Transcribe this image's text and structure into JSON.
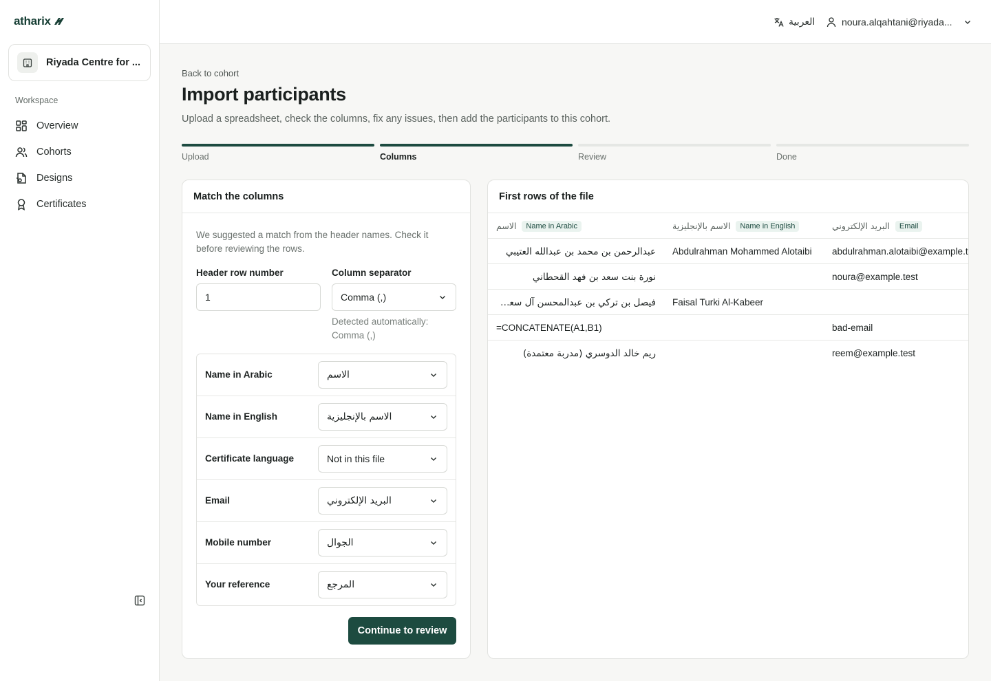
{
  "app": {
    "logo_text": "atharix",
    "organization": "Riyada Centre for ..."
  },
  "sidebar": {
    "section_label": "Workspace",
    "items": [
      {
        "label": "Overview",
        "icon": "grid-icon"
      },
      {
        "label": "Cohorts",
        "icon": "users-icon"
      },
      {
        "label": "Designs",
        "icon": "file-icon"
      },
      {
        "label": "Certificates",
        "icon": "award-icon"
      }
    ]
  },
  "topbar": {
    "language_label": "العربية",
    "user_email": "noura.alqahtani@riyada..."
  },
  "page": {
    "back_link": "Back to cohort",
    "title": "Import participants",
    "subtitle": "Upload a spreadsheet, check the columns, fix any issues, then add the participants to this cohort."
  },
  "stepper": {
    "steps": [
      {
        "label": "Upload",
        "state": "done"
      },
      {
        "label": "Columns",
        "state": "active"
      },
      {
        "label": "Review",
        "state": "pending"
      },
      {
        "label": "Done",
        "state": "pending"
      }
    ]
  },
  "columns_card": {
    "title": "Match the columns",
    "hint": "We suggested a match from the header names. Check it before reviewing the rows.",
    "header_row_label": "Header row number",
    "header_row_value": "1",
    "separator_label": "Column separator",
    "separator_value": "Comma (,)",
    "detected_text": "Detected automatically: Comma (,)",
    "mappings": [
      {
        "field": "Name in Arabic",
        "value": "الاسم"
      },
      {
        "field": "Name in English",
        "value": "الاسم بالإنجليزية"
      },
      {
        "field": "Certificate language",
        "value": "Not in this file"
      },
      {
        "field": "Email",
        "value": "البريد الإلكتروني"
      },
      {
        "field": "Mobile number",
        "value": "الجوال"
      },
      {
        "field": "Your reference",
        "value": "المرجع"
      }
    ],
    "continue_label": "Continue to review"
  },
  "preview_card": {
    "title": "First rows of the file",
    "columns": [
      {
        "header": "الاسم",
        "badge": "Name in Arabic"
      },
      {
        "header": "الاسم بالإنجليزية",
        "badge": "Name in English"
      },
      {
        "header": "البريد الإلكتروني",
        "badge": "Email"
      }
    ],
    "rows": [
      [
        "عبدالرحمن بن محمد بن عبدالله العتيبي",
        "Abdulrahman Mohammed Alotaibi",
        "abdulrahman.alotaibi@example.t"
      ],
      [
        "نورة بنت سعد بن فهد القحطاني",
        "",
        "noura@example.test"
      ],
      [
        "فيصل بن تركي بن عبدالمحسن آل سعود الكبير",
        "Faisal Turki Al-Kabeer",
        ""
      ],
      [
        "=CONCATENATE(A1,B1)",
        "",
        "bad-email"
      ],
      [
        "ريم خالد الدوسري (مدربة معتمدة)",
        "",
        "reem@example.test"
      ]
    ]
  },
  "colors": {
    "brand": "#1d4b40",
    "badge_bg": "#eaf3ef"
  }
}
